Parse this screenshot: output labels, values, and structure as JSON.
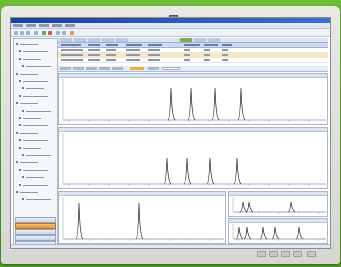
{
  "device": {
    "logo_icon": "monitor-brand-logo",
    "bezel_buttons": [
      "menu",
      "down",
      "up",
      "input",
      "power"
    ]
  },
  "app": {
    "accent": "#3b6fd0",
    "highlight": "#e89a3c",
    "selection": "#fde7b8"
  },
  "sidebar": {
    "tree_nodes": 22,
    "buttons": [
      {
        "name": "nav-button-1",
        "active": false
      },
      {
        "name": "nav-button-2",
        "active": true
      },
      {
        "name": "nav-button-3",
        "active": false
      },
      {
        "name": "nav-button-4",
        "active": false
      },
      {
        "name": "nav-button-5",
        "active": false
      }
    ]
  },
  "grid": {
    "rows": 3,
    "selected_row": 1
  },
  "charts": {
    "upper_peaks": 4,
    "middle_peaks": 4,
    "lower_left_peaks": 2,
    "lower_right_top_peaks": 3,
    "lower_right_bottom_peaks": 5
  }
}
